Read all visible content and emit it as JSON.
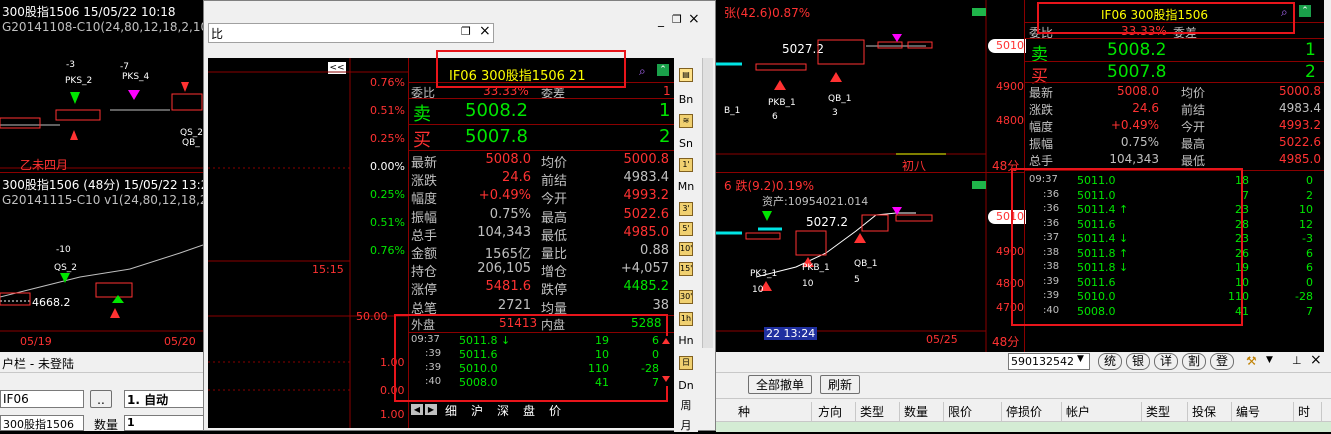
{
  "left_chart_top": {
    "title": "300股指1506 15/05/22 10:18",
    "subtitle": "G20141108-C10(24,80,12,18,2,103",
    "markers": [
      "-3",
      "PKS_2",
      "-7",
      "PKS_4",
      "QS_2",
      "QB_"
    ],
    "footer": "乙未四月"
  },
  "left_chart_bottom": {
    "title": "300股指1506 (48分) 15/05/22 13:2",
    "subtitle": "G20141115-C10 v1(24,80,12,18,2,",
    "markers": [
      "-10",
      "QS_2"
    ],
    "price_label": "4668.2",
    "dates": [
      "05/19",
      "05/20"
    ]
  },
  "popup": {
    "title_tail": "比",
    "controls": {
      "minimize": "_",
      "restore": "❐",
      "close": "×"
    },
    "chart_btn": "<<",
    "percent_ticks": [
      "0.76%",
      "0.51%",
      "0.25%",
      "0.00%",
      "0.25%",
      "0.51%",
      "0.76%"
    ],
    "time_label": "15:15",
    "vol_ticks": [
      "50.00",
      "1.00",
      "0.00",
      "1.00"
    ],
    "header": "IF06  300股指1506  21",
    "weibi_label": "委比",
    "weibi_val": "33.33%",
    "weicha_label": "委差",
    "weicha_val": "1",
    "sell_label": "卖",
    "sell_price": "5008.2",
    "sell_vol": "1",
    "buy_label": "买",
    "buy_price": "5007.8",
    "buy_vol": "2",
    "quotes": [
      {
        "l1": "最新",
        "v1": "5008.0",
        "c1": "red",
        "l2": "均价",
        "v2": "5000.8",
        "c2": "red"
      },
      {
        "l1": "涨跌",
        "v1": "24.6",
        "c1": "red",
        "l2": "前结",
        "v2": "4983.4",
        "c2": "gry"
      },
      {
        "l1": "幅度",
        "v1": "+0.49%",
        "c1": "red",
        "l2": "今开",
        "v2": "4993.2",
        "c2": "red"
      },
      {
        "l1": "振幅",
        "v1": "0.75%",
        "c1": "gry",
        "l2": "最高",
        "v2": "5022.6",
        "c2": "red"
      },
      {
        "l1": "总手",
        "v1": "104,343",
        "c1": "gry",
        "l2": "最低",
        "v2": "4985.0",
        "c2": "red"
      },
      {
        "l1": "金额",
        "v1": "1565亿",
        "c1": "gry",
        "l2": "量比",
        "v2": "0.88",
        "c2": "gry"
      },
      {
        "l1": "持仓",
        "v1": "206,105",
        "c1": "gry",
        "l2": "增仓",
        "v2": "+4,057",
        "c2": "gry"
      },
      {
        "l1": "涨停",
        "v1": "5481.6",
        "c1": "red",
        "l2": "跌停",
        "v2": "4485.2",
        "c2": "grn"
      },
      {
        "l1": "总笔",
        "v1": "2721",
        "c1": "gry",
        "l2": "均量",
        "v2": "38",
        "c2": "gry"
      }
    ],
    "outer_label": "外盘",
    "outer_val": "51413",
    "inner_label": "内盘",
    "inner_val": "5288",
    "ticks": [
      {
        "t": "09:37",
        "p": "5011.8 ↓",
        "pc": "grn",
        "v": "19",
        "d": "6"
      },
      {
        "t": ":39",
        "p": "5011.6",
        "pc": "grn",
        "v": "10",
        "d": "0"
      },
      {
        "t": ":39",
        "p": "5010.0",
        "pc": "grn",
        "v": "110",
        "d": "-28"
      },
      {
        "t": ":40",
        "p": "5008.0",
        "pc": "grn",
        "v": "41",
        "d": "7"
      }
    ],
    "tabs": [
      "细",
      "沪",
      "深",
      "盘",
      "价"
    ],
    "side_toolbar": [
      "Bn",
      "Sn",
      "Mn",
      "Hn",
      "Dn",
      "周",
      "月"
    ]
  },
  "right_chart_top": {
    "title_tail": "张(42.6)0.87%",
    "price_5027": "5027.2",
    "price_axis": [
      "5010",
      "4900",
      "4800"
    ],
    "markers": [
      "PKB_1",
      "QB_1",
      "6",
      "3",
      "B_1"
    ],
    "footer": "初八",
    "minutes": "48分"
  },
  "right_chart_bottom": {
    "title_tail": "6 跌(9.2)0.19%",
    "asset_text": "资产:10954021.014",
    "price_5027": "5027.2",
    "price_axis": [
      "5010",
      "4900",
      "4800",
      "4700"
    ],
    "markers": [
      "PKB_1",
      "QB_1",
      "PK3_1",
      "10",
      "10",
      "5"
    ],
    "time_label": "22 13:24",
    "date_label": "05/25",
    "minutes": "48分"
  },
  "right_quote": {
    "header": "IF06  300股指1506",
    "weibi_label": "委比",
    "weibi_val": "33.33%",
    "weicha_label": "委差",
    "sell_label": "卖",
    "sell_price": "5008.2",
    "sell_vol": "1",
    "buy_label": "买",
    "buy_price": "5007.8",
    "buy_vol": "2",
    "quotes": [
      {
        "l1": "最新",
        "v1": "5008.0",
        "c1": "red",
        "l2": "均价",
        "v2": "5000.8",
        "c2": "red"
      },
      {
        "l1": "涨跌",
        "v1": "24.6",
        "c1": "red",
        "l2": "前结",
        "v2": "4983.4",
        "c2": "gry"
      },
      {
        "l1": "幅度",
        "v1": "+0.49%",
        "c1": "red",
        "l2": "今开",
        "v2": "4993.2",
        "c2": "red"
      },
      {
        "l1": "振幅",
        "v1": "0.75%",
        "c1": "gry",
        "l2": "最高",
        "v2": "5022.6",
        "c2": "red"
      },
      {
        "l1": "总手",
        "v1": "104,343",
        "c1": "gry",
        "l2": "最低",
        "v2": "4985.0",
        "c2": "red"
      }
    ],
    "ticks": [
      {
        "t": "09:37",
        "p": "5011.0",
        "pc": "grn",
        "v": "18",
        "d": "0"
      },
      {
        "t": ":36",
        "p": "5011.0",
        "pc": "grn",
        "v": "7",
        "d": "2"
      },
      {
        "t": ":36",
        "p": "5011.4 ↑",
        "pc": "grn",
        "v": "23",
        "d": "10"
      },
      {
        "t": ":36",
        "p": "5011.6",
        "pc": "grn",
        "v": "28",
        "d": "12"
      },
      {
        "t": ":37",
        "p": "5011.4 ↓",
        "pc": "grn",
        "v": "23",
        "d": "-3"
      },
      {
        "t": ":38",
        "p": "5011.8 ↑",
        "pc": "grn",
        "v": "26",
        "d": "6"
      },
      {
        "t": ":38",
        "p": "5011.8 ↓",
        "pc": "grn",
        "v": "19",
        "d": "6"
      },
      {
        "t": ":39",
        "p": "5011.6",
        "pc": "grn",
        "v": "10",
        "d": "0"
      },
      {
        "t": ":39",
        "p": "5010.0",
        "pc": "grn",
        "v": "110",
        "d": "-28"
      },
      {
        "t": ":40",
        "p": "5008.0",
        "pc": "grn",
        "v": "41",
        "d": "7"
      }
    ]
  },
  "bottom": {
    "toolbar_title": "户栏 - 未登陆",
    "code_value": "IF06",
    "name_value": "300股指1506",
    "dots_btn": "..",
    "mode_value": "1. 自动",
    "qty_label": "数量",
    "qty_value": "1",
    "account_value": "590132542",
    "action_btns": [
      "统",
      "银",
      "详",
      "割",
      "登"
    ],
    "cancel_all": "全部撤单",
    "refresh": "刷新",
    "columns": [
      "种",
      "方向",
      "类型",
      "数量",
      "限价",
      "停损价",
      "帐户",
      "类型",
      "投保",
      "编号",
      "时"
    ]
  }
}
